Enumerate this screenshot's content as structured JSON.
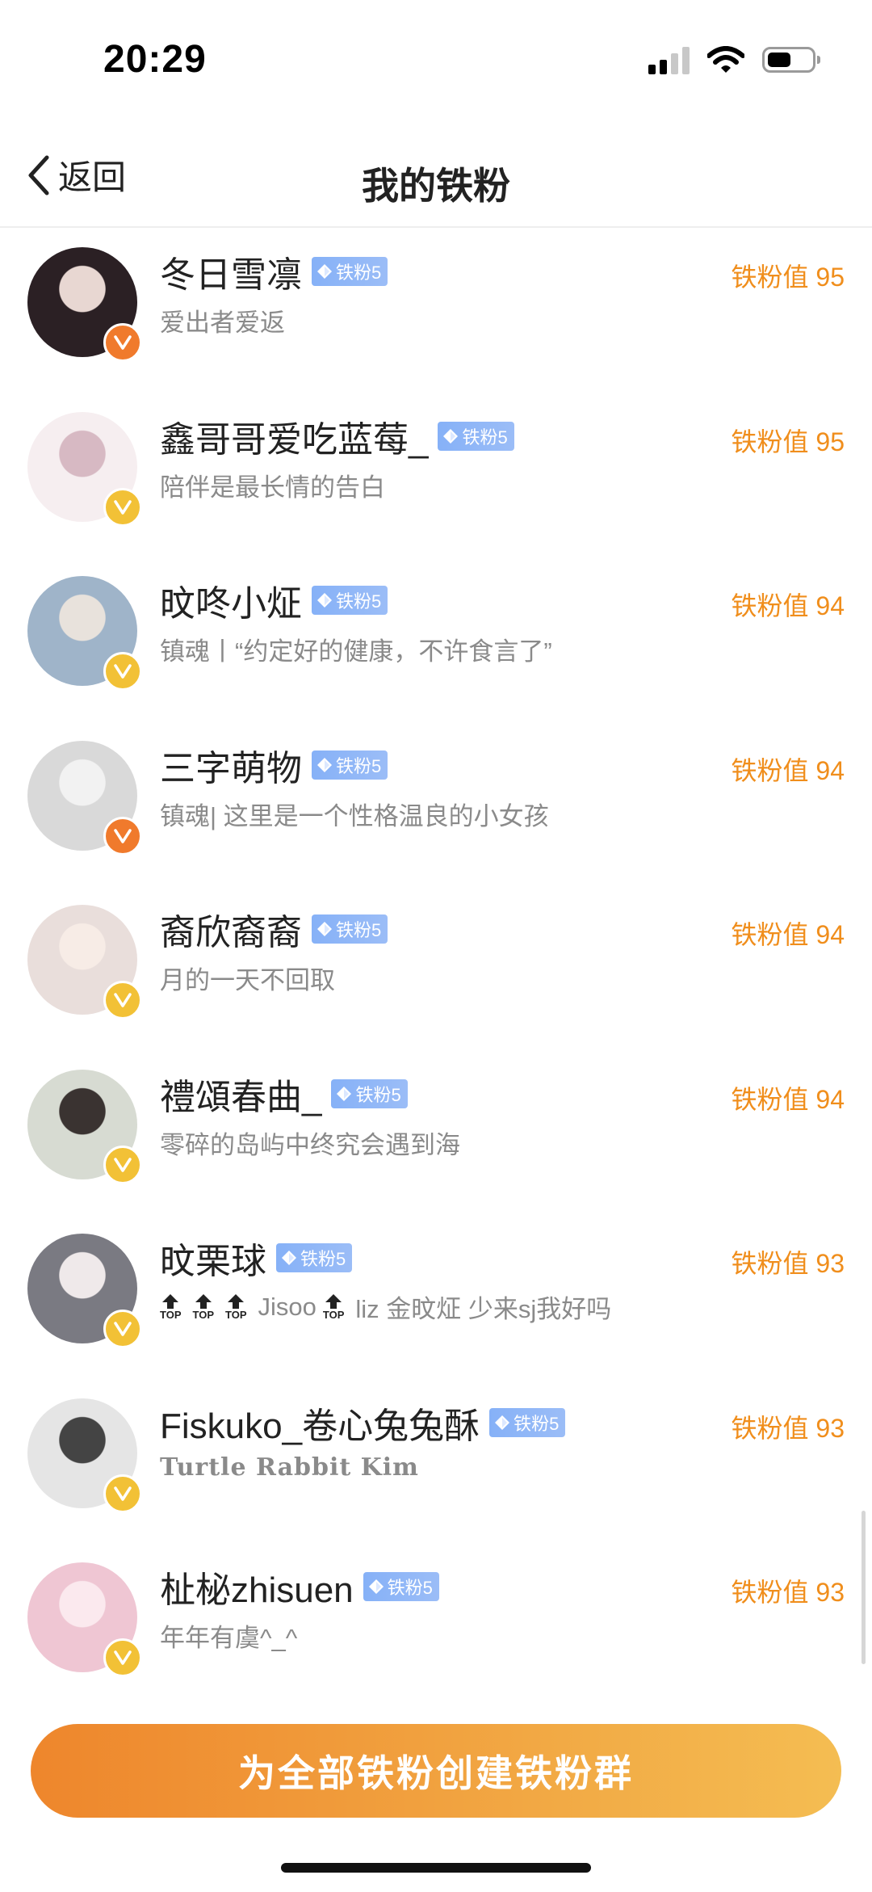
{
  "status_bar": {
    "time": "20:29"
  },
  "nav": {
    "back_label": "返回",
    "title": "我的铁粉"
  },
  "fans": [
    {
      "name": "冬日雪凛",
      "badge": "铁粉5",
      "score": "铁粉值 95",
      "bio": "爱出者爱返",
      "v_color": "#f07a2c",
      "avatar_bg": "#2b2024",
      "avatar_fg": "#e8d7d2"
    },
    {
      "name": "鑫哥哥爱吃蓝莓_",
      "badge": "铁粉5",
      "score": "铁粉值 95",
      "bio": "陪伴是最长情的告白",
      "v_color": "#f2c136",
      "avatar_bg": "#f6eef0",
      "avatar_fg": "#d7b9c3"
    },
    {
      "name": "旼咚小炡",
      "badge": "铁粉5",
      "score": "铁粉值 94",
      "bio": "镇魂丨“约定好的健康，不许食言了”",
      "v_color": "#f2c136",
      "avatar_bg": "#9fb4c9",
      "avatar_fg": "#e8e2dc"
    },
    {
      "name": "三字萌物",
      "badge": "铁粉5",
      "score": "铁粉值 94",
      "bio": "镇魂| 这里是一个性格温良的小女孩",
      "v_color": "#f07a2c",
      "avatar_bg": "#d9d9d9",
      "avatar_fg": "#f2f2f2"
    },
    {
      "name": "裔欣裔裔",
      "badge": "铁粉5",
      "score": "铁粉值 94",
      "bio": "月的一天不回取",
      "v_color": "#f2c136",
      "avatar_bg": "#e9dedb",
      "avatar_fg": "#f7ece6"
    },
    {
      "name": "禮頌春曲_",
      "badge": "铁粉5",
      "score": "铁粉值 94",
      "bio": "零碎的岛屿中终究会遇到海",
      "v_color": "#f2c136",
      "avatar_bg": "#d7dbd2",
      "avatar_fg": "#3a3331"
    },
    {
      "name": "旼栗球",
      "badge": "铁粉5",
      "score": "铁粉值 93",
      "bio_tops": [
        "TOP",
        "TOP",
        "TOP",
        "TOP"
      ],
      "bio_words": [
        "Jisoo",
        "liz 金旼炡 少来sj我好吗"
      ],
      "v_color": "#f2c136",
      "avatar_bg": "#7a7a82",
      "avatar_fg": "#efe9ea"
    },
    {
      "name": "Fiskuko_卷心兔兔酥",
      "badge": "铁粉5",
      "score": "铁粉值 93",
      "bio": "Turtle Rabbit Kim",
      "v_color": "#f2c136",
      "avatar_bg": "#e5e5e5",
      "avatar_fg": "#444444"
    },
    {
      "name": "杫柲zhisuen",
      "badge": "铁粉5",
      "score": "铁粉值 93",
      "bio": "年年有虞^_^",
      "v_color": "#f2c136",
      "avatar_bg": "#efc6d3",
      "avatar_fg": "#fbe9ee"
    }
  ],
  "cta": {
    "label": "为全部铁粉创建铁粉群"
  },
  "colors": {
    "accent": "#f08e1c",
    "badge_blue": "#8fb6f7",
    "cta_start": "#ee862c",
    "cta_end": "#f4bd52"
  }
}
